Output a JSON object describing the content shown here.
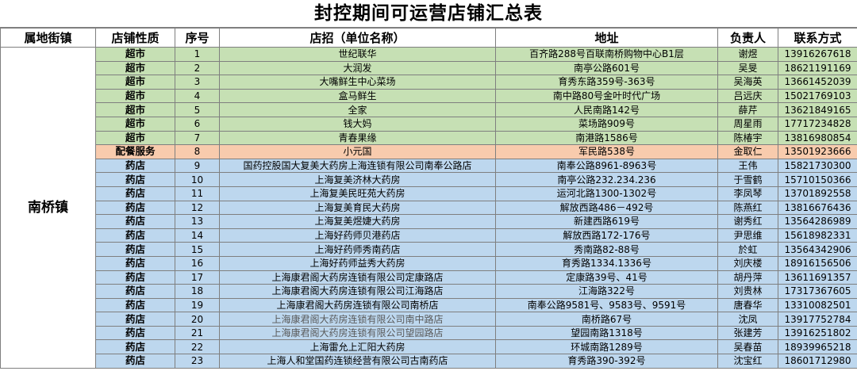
{
  "title": "封控期间可运营店铺汇总表",
  "headers": {
    "town": "属地街镇",
    "type": "店铺性质",
    "no": "序号",
    "name": "店招（单位名称）",
    "address": "地址",
    "manager": "负责人",
    "contact": "联系方式"
  },
  "town": "南桥镇",
  "colors": {
    "supermarket": "#c6e0b4",
    "catering": "#f8cbad",
    "pharmacy": "#bdd7ee",
    "border": "#7f7f7f"
  },
  "rows": [
    {
      "type": "超市",
      "no": "1",
      "name": "世纪联华",
      "address": "百齐路288号百联南桥购物中心B1层",
      "manager": "谢煜",
      "contact": "13916267618",
      "cat": "supermarket"
    },
    {
      "type": "超市",
      "no": "2",
      "name": "大润发",
      "address": "南亭公路601号",
      "manager": "吴旻",
      "contact": "18621191169",
      "cat": "supermarket"
    },
    {
      "type": "超市",
      "no": "3",
      "name": "大嘴鲜生中心菜场",
      "address": "育秀东路359号-363号",
      "manager": "吴海英",
      "contact": "13661452039",
      "cat": "supermarket"
    },
    {
      "type": "超市",
      "no": "4",
      "name": "盒马鲜生",
      "address": "南中路80号金叶时代广场",
      "manager": "吕远庆",
      "contact": "15021769103",
      "cat": "supermarket"
    },
    {
      "type": "超市",
      "no": "5",
      "name": "全家",
      "address": "人民南路142号",
      "manager": "薛芹",
      "contact": "13621849165",
      "cat": "supermarket"
    },
    {
      "type": "超市",
      "no": "6",
      "name": "钱大妈",
      "address": "菜场路909号",
      "manager": "周星雨",
      "contact": "17717234828",
      "cat": "supermarket"
    },
    {
      "type": "超市",
      "no": "7",
      "name": "青春果缘",
      "address": "南港路1586号",
      "manager": "陈椿宇",
      "contact": "13816980854",
      "cat": "supermarket"
    },
    {
      "type": "配餐服务",
      "no": "8",
      "name": "小元国",
      "address": "军民路538号",
      "manager": "金取仁",
      "contact": "13501923666",
      "cat": "catering"
    },
    {
      "type": "药店",
      "no": "9",
      "name": "国药控股国大复美大药房上海连锁有限公司南奉公路店",
      "address": "南奉公路8961-8963号",
      "manager": "王伟",
      "contact": "15821730300",
      "cat": "pharmacy"
    },
    {
      "type": "药店",
      "no": "10",
      "name": "上海复美济林大药房",
      "address": "南亭公路232.234.236",
      "manager": "于雪鹤",
      "contact": "15710150366",
      "cat": "pharmacy"
    },
    {
      "type": "药店",
      "no": "11",
      "name": "上海复美民旺苑大药房",
      "address": "运河北路1300-1302号",
      "manager": "李凤琴",
      "contact": "13701892558",
      "cat": "pharmacy"
    },
    {
      "type": "药店",
      "no": "12",
      "name": "上海复美育民大药房",
      "address": "解放西路486－492号",
      "manager": "陈燕红",
      "contact": "13816676436",
      "cat": "pharmacy"
    },
    {
      "type": "药店",
      "no": "13",
      "name": "上海复美煜婕大药房",
      "address": "新建西路619号",
      "manager": "谢秀红",
      "contact": "13564286989",
      "cat": "pharmacy"
    },
    {
      "type": "药店",
      "no": "14",
      "name": "上海好药师贝港药店",
      "address": "解放西路172-176号",
      "manager": "尹思维",
      "contact": "15618982331",
      "cat": "pharmacy"
    },
    {
      "type": "药店",
      "no": "15",
      "name": "上海好药师秀南药店",
      "address": "秀南路82-88号",
      "manager": "於虹",
      "contact": "13564342906",
      "cat": "pharmacy"
    },
    {
      "type": "药店",
      "no": "16",
      "name": "上海好药师益秀大药房",
      "address": "育秀路1334.1336号",
      "manager": "刘庆楼",
      "contact": "18916156506",
      "cat": "pharmacy"
    },
    {
      "type": "药店",
      "no": "17",
      "name": "上海康君阁大药房连锁有限公司定康路店",
      "address": "定康路39号、41号",
      "manager": "胡丹萍",
      "contact": "13611691357",
      "cat": "pharmacy"
    },
    {
      "type": "药店",
      "no": "18",
      "name": "上海康君阁大药房连锁有限公司江海路店",
      "address": "江海路322号",
      "manager": "刘贵林",
      "contact": "17317367605",
      "cat": "pharmacy"
    },
    {
      "type": "药店",
      "no": "19",
      "name": "上海康君阁大药房连锁有限公司南桥店",
      "address": "南奉公路9581号、9583号、9591号",
      "manager": "唐春华",
      "contact": "13310082501",
      "cat": "pharmacy"
    },
    {
      "type": "药店",
      "no": "20",
      "name": "上海康君阁大药房连锁有限公司南中路店",
      "address": "南桥路67号",
      "manager": "沈凤",
      "contact": "13917752784",
      "cat": "pharmacy",
      "gray": true
    },
    {
      "type": "药店",
      "no": "21",
      "name": "上海康君阁大药房连锁有限公司望园路店",
      "address": "望园南路1318号",
      "manager": "张建芳",
      "contact": "13916251802",
      "cat": "pharmacy",
      "gray": true
    },
    {
      "type": "药店",
      "no": "22",
      "name": "上海雷允上汇阳大药房",
      "address": "环城南路1289号",
      "manager": "吴春苗",
      "contact": "18939965218",
      "cat": "pharmacy"
    },
    {
      "type": "药店",
      "no": "23",
      "name": "上海人和堂国药连锁经营有限公司古南药店",
      "address": "育秀路390-392号",
      "manager": "沈宝红",
      "contact": "18601712980",
      "cat": "pharmacy"
    }
  ]
}
